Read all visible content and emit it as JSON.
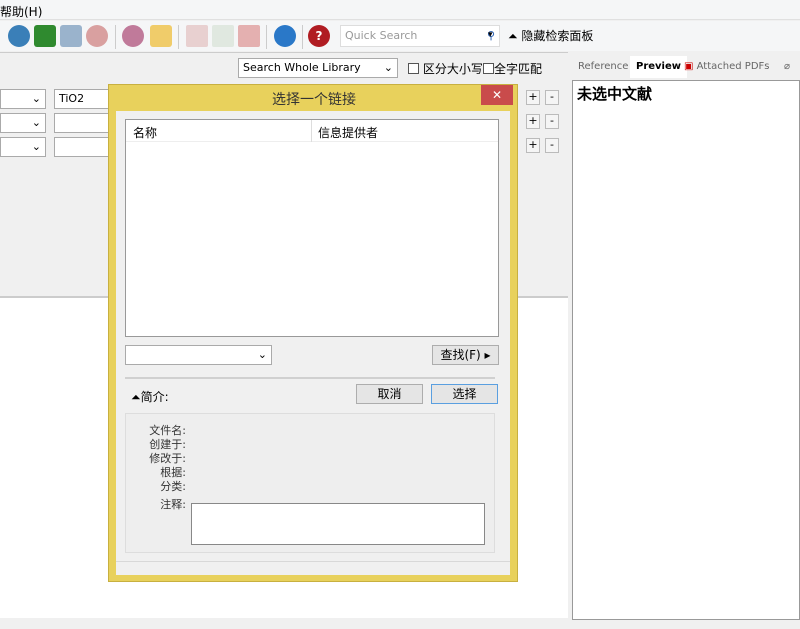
{
  "menu": {
    "help": "帮助(H)"
  },
  "toolbar": {
    "icons": [
      "search-icon",
      "back-arrow-icon",
      "up-arrow-icon",
      "web-import-icon",
      "globe-icon",
      "folder-icon",
      "import-doc-icon",
      "checklist-icon",
      "edit-doc-icon",
      "sync-icon",
      "help-icon"
    ],
    "quick_search_placeholder": "Quick Search",
    "hide_panel": "隐藏检索面板"
  },
  "search_panel": {
    "scope": "Search Whole Library",
    "case_sensitive": "区分大小写",
    "whole_word": "全字匹配",
    "rows": [
      {
        "value": "TiO2"
      },
      {
        "value": ""
      },
      {
        "value": ""
      }
    ],
    "plus": "+",
    "minus": "-"
  },
  "right_panel": {
    "tabs": [
      "Reference",
      "Preview",
      "Attached PDFs"
    ],
    "active_tab": "Preview",
    "message": "未选中文献"
  },
  "dialog": {
    "title": "选择一个链接",
    "columns": [
      "名称",
      "信息提供者"
    ],
    "find_button": "查找(F)",
    "summary": "简介:",
    "cancel": "取消",
    "select": "选择",
    "fields": [
      "文件名:",
      "创建于:",
      "修改于:",
      "根据:",
      "分类:"
    ],
    "notes_label": "注释:"
  },
  "colors": {
    "dialog_frame": "#e8d15c",
    "close_button": "#c94b4b",
    "select_border": "#5a9fe0"
  }
}
